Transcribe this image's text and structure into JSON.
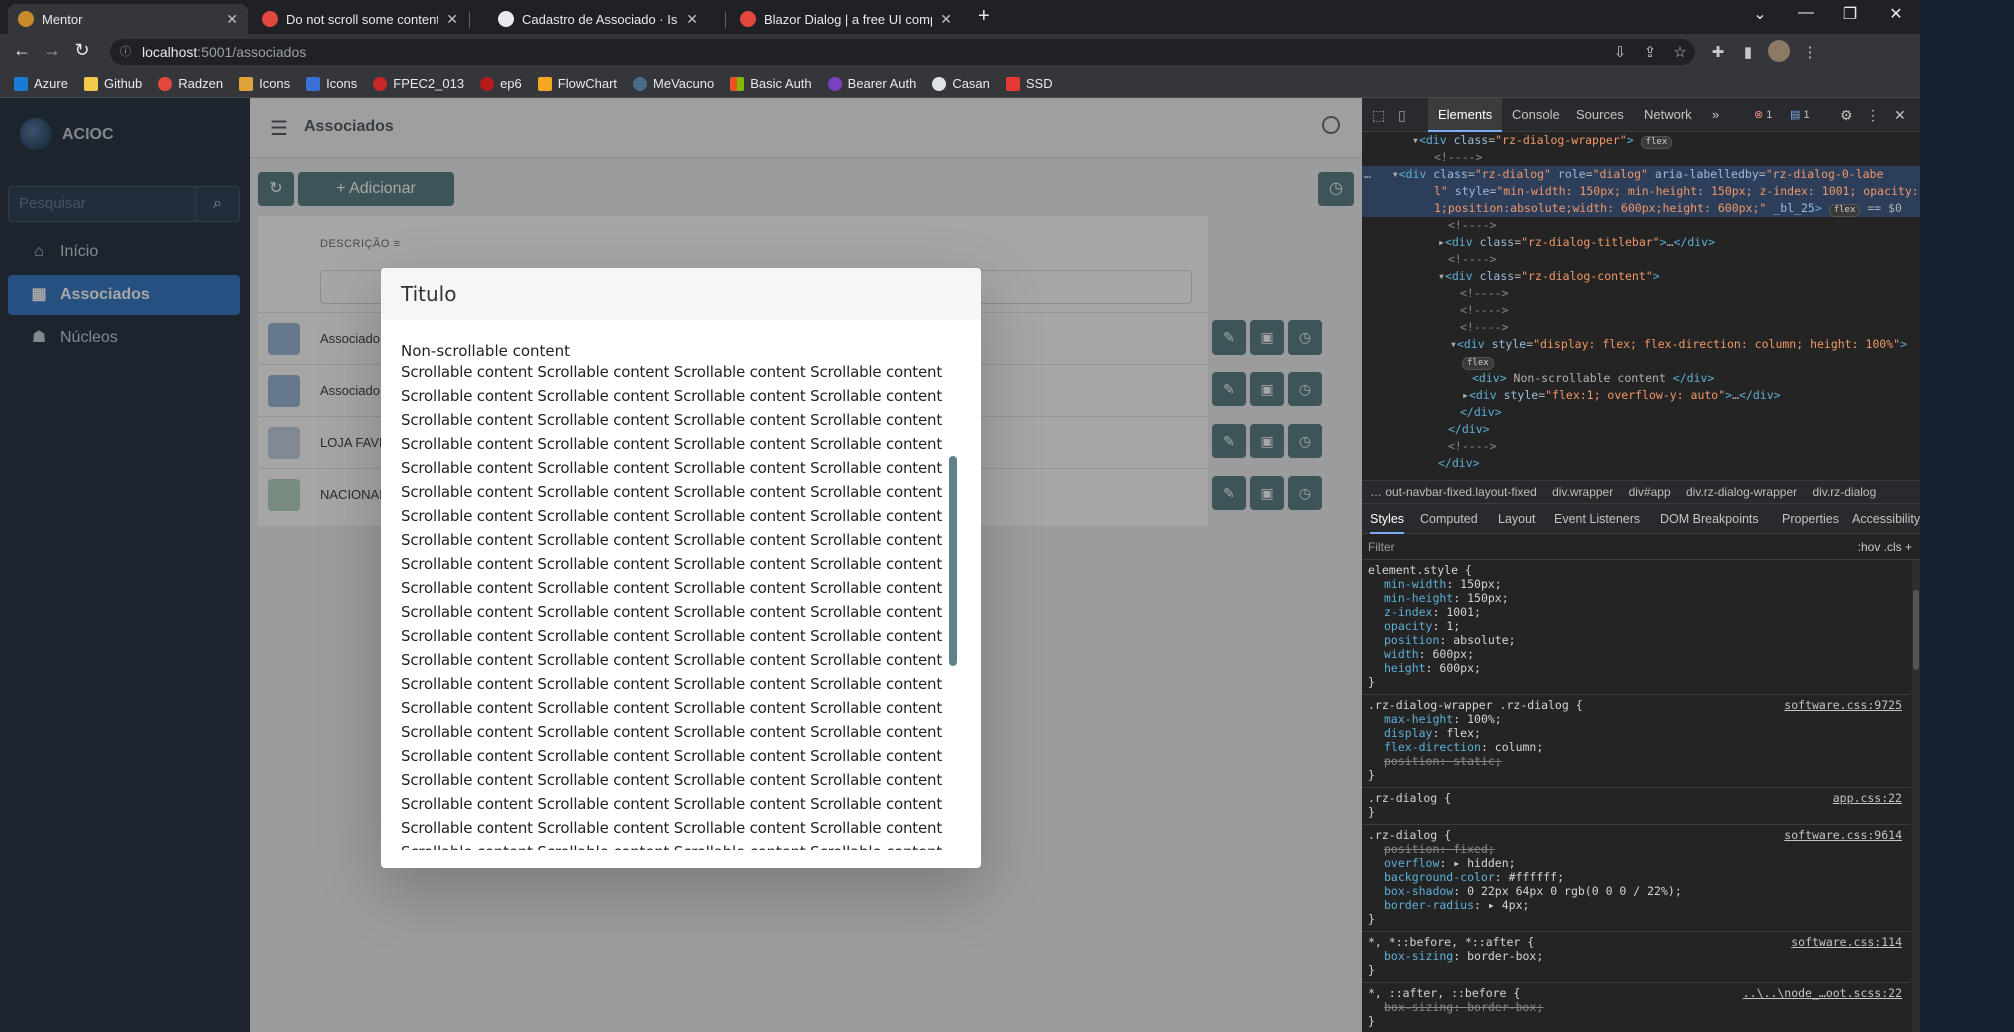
{
  "tabs": [
    {
      "title": "Mentor",
      "active": true
    },
    {
      "title": "Do not scroll some content on Ra"
    },
    {
      "title": "Cadastro de Associado · Issue"
    },
    {
      "title": "Blazor Dialog | a free UI compon"
    }
  ],
  "address": {
    "host": "localhost",
    "path": ":5001/associados"
  },
  "bookmarks": [
    "Azure",
    "Github",
    "Radzen",
    "Icons",
    "Icons",
    "FPEC2_013",
    "ep6",
    "FlowChart",
    "MeVacuno",
    "Basic Auth",
    "Bearer Auth",
    "Casan",
    "SSD"
  ],
  "app": {
    "name": "ACIOC",
    "search_placeholder": "Pesquisar",
    "nav": [
      "Início",
      "Associados",
      "Núcleos"
    ],
    "header_title": "Associados",
    "add_label": "+  Adicionar",
    "grid_col": "DESCRIÇÃO",
    "rows": [
      "Associado",
      "Associado",
      "LOJA FAVR",
      "NACIONAL"
    ]
  },
  "dialog": {
    "title": "Titulo",
    "non_scrollable": "Non-scrollable content",
    "scroll_line": "Scrollable content Scrollable content Scrollable content Scrollable content"
  },
  "devtools": {
    "tabs": [
      "Elements",
      "Console",
      "Sources",
      "Network"
    ],
    "errors": "1",
    "messages": "1",
    "breadcrumbs": [
      "… out-navbar-fixed.layout-fixed",
      "div.wrapper",
      "div#app",
      "div.rz-dialog-wrapper",
      "div.rz-dialog"
    ],
    "style_tabs": [
      "Styles",
      "Computed",
      "Layout",
      "Event Listeners",
      "DOM Breakpoints",
      "Properties",
      "Accessibility"
    ],
    "filter": "Filter",
    "filter_right": ":hov  .cls  +",
    "rules": [
      {
        "selector": "element.style {",
        "source": "",
        "props": [
          [
            "min-width",
            "150px;"
          ],
          [
            "min-height",
            "150px;"
          ],
          [
            "z-index",
            "1001;"
          ],
          [
            "opacity",
            "1;"
          ],
          [
            "position",
            "absolute;"
          ],
          [
            "width",
            "600px;"
          ],
          [
            "height",
            "600px;"
          ]
        ]
      },
      {
        "selector": ".rz-dialog-wrapper .rz-dialog {",
        "source": "software.css:9725",
        "props": [
          [
            "max-height",
            "100%;"
          ],
          [
            "display",
            "flex;"
          ],
          [
            "flex-direction",
            "column;"
          ],
          [
            "position",
            "static;",
            "strike"
          ]
        ]
      },
      {
        "selector": ".rz-dialog {",
        "source": "app.css:22",
        "props": []
      },
      {
        "selector": ".rz-dialog {",
        "source": "software.css:9614",
        "props": [
          [
            "position",
            "fixed;",
            "strike"
          ],
          [
            "overflow",
            "▸ hidden;"
          ],
          [
            "background-color",
            "#ffffff;"
          ],
          [
            "box-shadow",
            "0 22px 64px 0 rgb(0 0 0 / 22%);"
          ],
          [
            "border-radius",
            "▸ 4px;"
          ]
        ]
      },
      {
        "selector": "*, *::before, *::after {",
        "source": "software.css:114",
        "props": [
          [
            "box-sizing",
            "border-box;"
          ]
        ]
      },
      {
        "selector": "*, ::after, ::before {",
        "source": "..\\..\\node_…oot.scss:22",
        "props": [
          [
            "box-sizing",
            "border-box;",
            "strike"
          ]
        ]
      }
    ]
  },
  "colors": {
    "accent": "#5e8287",
    "sidebar": "#2b3a48",
    "nav_selected": "#3b7cc4"
  }
}
